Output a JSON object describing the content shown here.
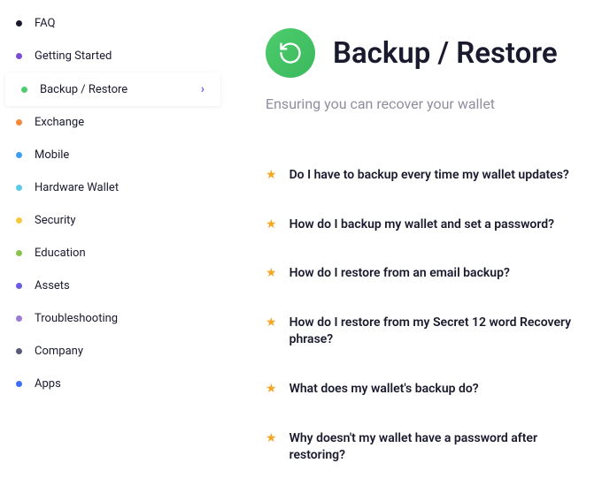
{
  "sidebar": {
    "items": [
      {
        "label": "FAQ",
        "color": "#1a1a2e",
        "active": false
      },
      {
        "label": "Getting Started",
        "color": "#7b4dd6",
        "active": false
      },
      {
        "label": "Backup / Restore",
        "color": "#4dcd6e",
        "active": true
      },
      {
        "label": "Exchange",
        "color": "#f5883b",
        "active": false
      },
      {
        "label": "Mobile",
        "color": "#3b9ff5",
        "active": false
      },
      {
        "label": "Hardware Wallet",
        "color": "#5bc9e8",
        "active": false
      },
      {
        "label": "Security",
        "color": "#f5c93b",
        "active": false
      },
      {
        "label": "Education",
        "color": "#8bc34a",
        "active": false
      },
      {
        "label": "Assets",
        "color": "#6b5ce7",
        "active": false
      },
      {
        "label": "Troubleshooting",
        "color": "#9b7bd6",
        "active": false
      },
      {
        "label": "Company",
        "color": "#5a5a7a",
        "active": false
      },
      {
        "label": "Apps",
        "color": "#3b6ff5",
        "active": false
      }
    ]
  },
  "main": {
    "title": "Backup / Restore",
    "subtitle": "Ensuring you can recover your wallet",
    "articles": [
      "Do I have to backup every time my wallet updates?",
      "How do I backup my wallet and set a password?",
      "How do I restore from an email backup?",
      "How do I restore from my Secret 12 word Recovery phrase?",
      "What does my wallet's backup do?",
      "Why doesn't my wallet have a password after restoring?"
    ]
  }
}
